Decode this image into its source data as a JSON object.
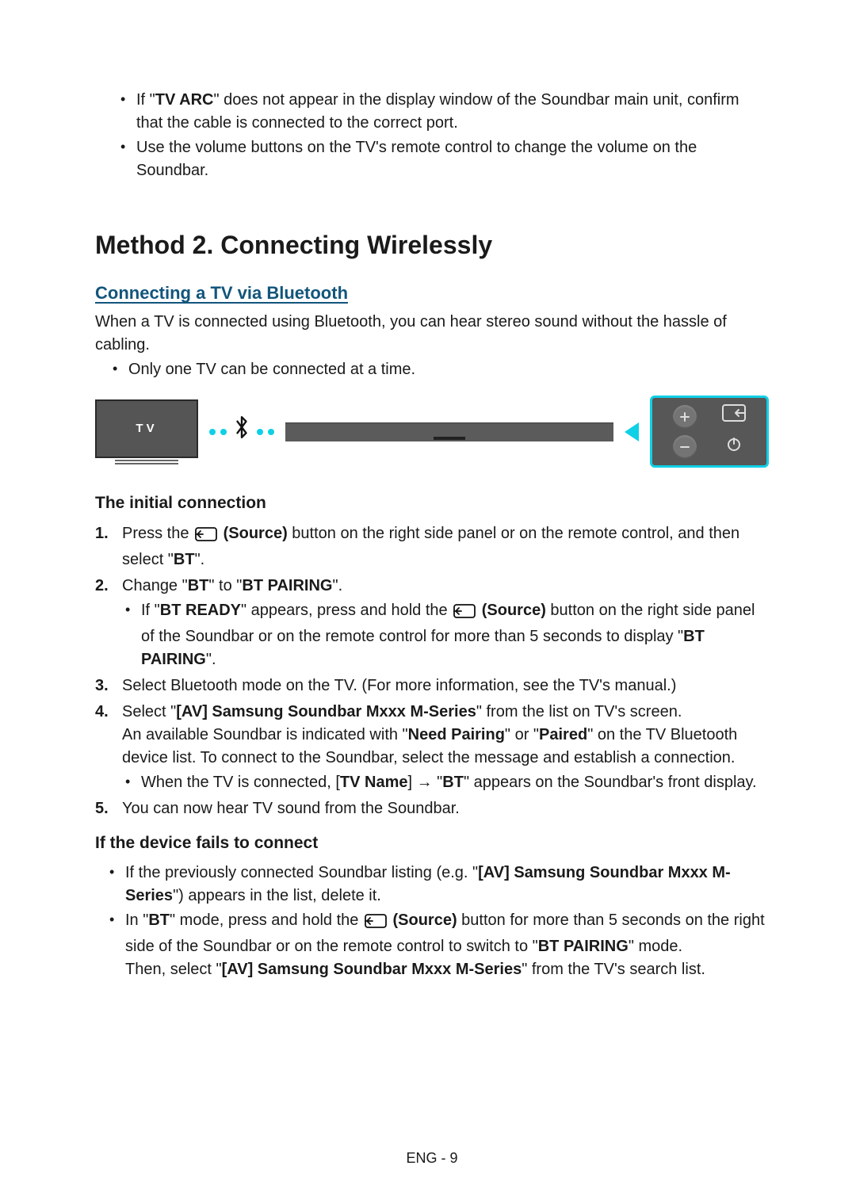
{
  "top_notes": {
    "items": [
      {
        "pre": "If \"",
        "b1": "TV ARC",
        "post": "\" does not appear in the display window of the Soundbar main unit, confirm that the cable is connected to the correct port."
      },
      {
        "plain": "Use the volume buttons on the TV's remote control to change the volume on the Soundbar."
      }
    ]
  },
  "section": {
    "title": "Method 2. Connecting Wirelessly",
    "sub_title": "Connecting a TV via Bluetooth",
    "intro": "When a TV is connected using Bluetooth, you can hear stereo sound without the hassle of cabling.",
    "intro_bullet": "Only one TV can be connected at a time."
  },
  "diagram": {
    "tv_label": "TV"
  },
  "initial": {
    "title": "The initial connection",
    "step1": {
      "pre": "Press the ",
      "icon_label": " (Source)",
      "mid": " button on the right side panel or on the remote control, and then select \"",
      "b": "BT",
      "post": "\"."
    },
    "step2": {
      "pre": "Change \"",
      "b1": "BT",
      "mid1": "\" to \"",
      "b2": "BT PAIRING",
      "post": "\"."
    },
    "step2_sub": {
      "pre": "If \"",
      "b1": "BT READY",
      "mid1": "\" appears, press and hold the ",
      "icon_label": " (Source)",
      "mid2": " button on the right side panel of the Soundbar or on the remote control for more than 5 seconds to display \"",
      "b2": "BT PAIRING",
      "post": "\"."
    },
    "step3": "Select Bluetooth mode on the TV. (For more information, see the TV's manual.)",
    "step4": {
      "line1_pre": "Select \"",
      "line1_b": "[AV] Samsung Soundbar Mxxx M-Series",
      "line1_post": "\" from the list on TV's screen.",
      "line2_pre": "An available Soundbar is indicated with \"",
      "line2_b1": "Need Pairing",
      "line2_mid": "\" or \"",
      "line2_b2": "Paired",
      "line2_post": "\" on the TV Bluetooth device list. To connect to the Soundbar, select the message and establish a connection.",
      "sub_pre": "When the TV is connected, [",
      "sub_b1": "TV Name",
      "sub_mid": "] → \"",
      "sub_b2": "BT",
      "sub_post": "\" appears on the Soundbar's front display."
    },
    "step5": "You can now hear TV sound from the Soundbar."
  },
  "fails": {
    "title": "If the device fails to connect",
    "b1": {
      "pre": "If the previously connected Soundbar listing (e.g. \"",
      "bold": "[AV] Samsung Soundbar Mxxx M-Series",
      "post": "\") appears in the list, delete it."
    },
    "b2": {
      "pre": "In \"",
      "b1": "BT",
      "mid1": "\" mode, press and hold the ",
      "icon_label": " (Source)",
      "mid2": " button for more than 5 seconds on the right side of the Soundbar or on the remote control to switch to \"",
      "b2": "BT PAIRING",
      "post": "\" mode."
    },
    "b2_line2": {
      "pre": "Then, select \"",
      "bold": "[AV] Samsung Soundbar Mxxx M-Series",
      "post": "\" from the TV's search list."
    }
  },
  "footer": "ENG - 9"
}
